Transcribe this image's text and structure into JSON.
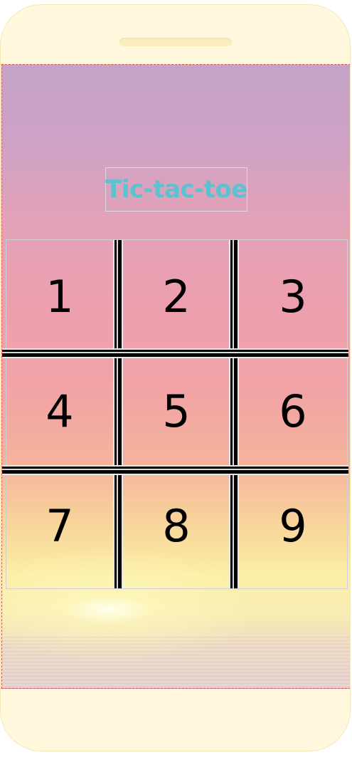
{
  "app": {
    "title": "Tic-tac-toe"
  },
  "board": {
    "cells": [
      "1",
      "2",
      "3",
      "4",
      "5",
      "6",
      "7",
      "8",
      "9"
    ]
  },
  "colors": {
    "title": "#5bc2cf",
    "phone_frame": "#fff8dc",
    "grid_lines": "#000000",
    "cell_text": "#000000",
    "screen_border": "#d9534f"
  }
}
